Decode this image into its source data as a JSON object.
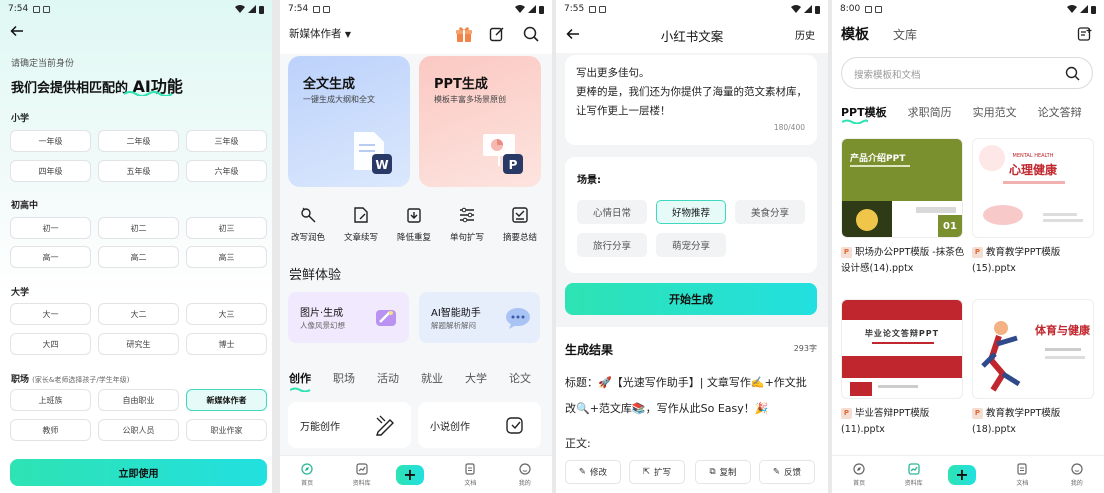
{
  "panel1": {
    "status_time": "7:54",
    "hint": "请确定当前身份",
    "headline_prefix": "我们会提供相匹配的",
    "headline_ai": "AI功能",
    "sections": {
      "primary": {
        "title": "小学",
        "options": [
          "一年级",
          "二年级",
          "三年级",
          "四年级",
          "五年级",
          "六年级"
        ]
      },
      "middle": {
        "title": "初高中",
        "options": [
          "初一",
          "初二",
          "初三",
          "高一",
          "高二",
          "高三"
        ]
      },
      "college": {
        "title": "大学",
        "options": [
          "大一",
          "大二",
          "大三",
          "大四",
          "研究生",
          "博士"
        ]
      },
      "work": {
        "title": "职场",
        "note": "(家长&老师选择孩子/学生年级)",
        "options": [
          "上班族",
          "自由职业",
          "新媒体作者",
          "教师",
          "公职人员",
          "职业作家"
        ],
        "selected": "新媒体作者"
      }
    },
    "cta": "立即使用"
  },
  "panel2": {
    "status_time": "7:54",
    "role": "新媒体作者",
    "cards": [
      {
        "title": "全文生成",
        "subtitle": "一键生成大纲和全文",
        "badge": "W"
      },
      {
        "title": "PPT生成",
        "subtitle": "模板丰富多场景原创",
        "badge": "P"
      }
    ],
    "tools": [
      "改写润色",
      "文章续写",
      "降低重复",
      "单句扩写",
      "摘要总结"
    ],
    "try_heading": "尝鲜体验",
    "try_cards": [
      {
        "title": "图片·生成",
        "subtitle": "人像风景幻想"
      },
      {
        "title": "AI智能助手",
        "subtitle": "解题解析解闷"
      }
    ],
    "tabs": [
      "创作",
      "职场",
      "活动",
      "就业",
      "大学",
      "论文"
    ],
    "features": [
      "万能创作",
      "小说创作"
    ],
    "nav": [
      "首页",
      "资料库",
      "",
      "文档",
      "我的"
    ]
  },
  "panel3": {
    "status_time": "7:55",
    "title": "小红书文案",
    "history": "历史",
    "input_text": "写出更多佳句。\n更棒的是，我们还为你提供了海量的范文素材库，让写作更上一层楼！",
    "count": "180/400",
    "scene_label": "场景:",
    "scenes": [
      "心情日常",
      "好物推荐",
      "美食分享",
      "旅行分享",
      "萌宠分享"
    ],
    "selected_scene": "好物推荐",
    "generate": "开始生成",
    "result_heading": "生成结果",
    "word_count": "293字",
    "result_text": "标题：🚀【光速写作助手】| 文章写作✍️+作文批改🔍+范文库📚，写作从此So Easy！🎉",
    "body_label": "正文:",
    "actions": [
      "修改",
      "扩写",
      "复制",
      "反馈"
    ]
  },
  "panel4": {
    "status_time": "8:00",
    "title": "模板",
    "library": "文库",
    "search_placeholder": "搜索模板和文档",
    "tabs": [
      "PPT模板",
      "求职简历",
      "实用范文",
      "论文答辩"
    ],
    "templates": [
      {
        "name": "职场办公PPT模版 -抹茶色设计感(14).pptx",
        "thumb_title": "产品介绍PPT",
        "thumb_num": "01"
      },
      {
        "name": "教育教学PPT模版(15).pptx",
        "thumb_title": "心理健康",
        "thumb_sub": "MENTAL HEALTH"
      },
      {
        "name": "毕业答辩PPT模版(11).pptx",
        "thumb_title": "毕业论文答辩PPT"
      },
      {
        "name": "教育教学PPT模版(18).pptx",
        "thumb_title": "体育与健康"
      }
    ],
    "nav": [
      "首页",
      "资料库",
      "",
      "文档",
      "我的"
    ]
  },
  "colors": {
    "accent": "#2ee3b3",
    "accent2": "#22e0e0",
    "blue_card": "#cfe0fb",
    "pink_card": "#fde0dc",
    "olive": "#7a8f2e",
    "red": "#c0262d"
  }
}
